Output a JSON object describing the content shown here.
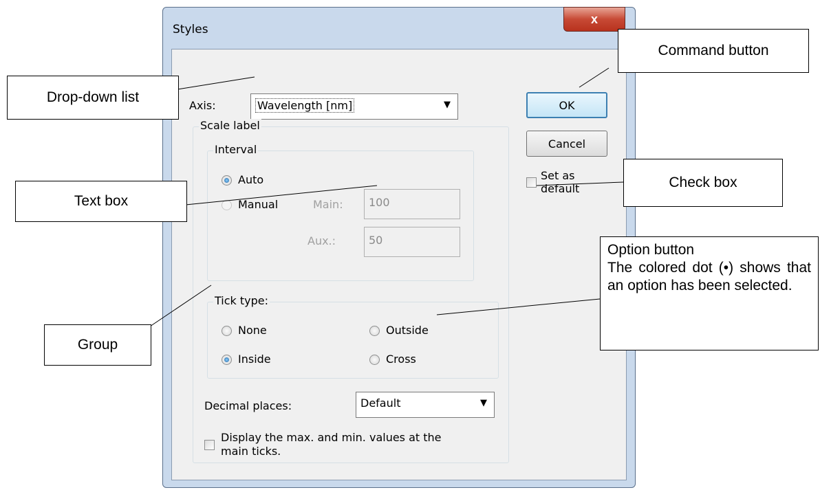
{
  "dialog": {
    "title": "Styles",
    "close_glyph": "x",
    "axis_label": "Axis:",
    "axis_value": "Wavelength [nm]",
    "ok_label": "OK",
    "cancel_label": "Cancel",
    "set_default": {
      "line1": "Set as",
      "line2": "default",
      "checked": false
    },
    "scale_label_group": "Scale label",
    "interval_group": "Interval",
    "auto_label": "Auto",
    "manual_label": "Manual",
    "main_label": "Main:",
    "main_value": "100",
    "aux_label": "Aux.:",
    "aux_value": "50",
    "interval_selected": "Auto",
    "tick_type_group": "Tick type:",
    "tick_none": "None",
    "tick_inside": "Inside",
    "tick_outside": "Outside",
    "tick_cross": "Cross",
    "tick_selected": "Inside",
    "decimal_label": "Decimal places:",
    "decimal_value": "Default",
    "display_minmax": {
      "line1": "Display the max. and min. values at the",
      "line2": "main ticks.",
      "checked": false
    }
  },
  "callouts": {
    "command_button": "Command button",
    "drop_down_list": "Drop-down list",
    "text_box": "Text box",
    "check_box": "Check box",
    "option_button_title": "Option button",
    "option_button_desc": "The colored dot (•) shows that an option has been selected.",
    "group": "Group"
  },
  "colors": {
    "window_frame": "#c9d9ec",
    "close_button": "#c74a35",
    "radio_dot": "#1c5f9e"
  }
}
